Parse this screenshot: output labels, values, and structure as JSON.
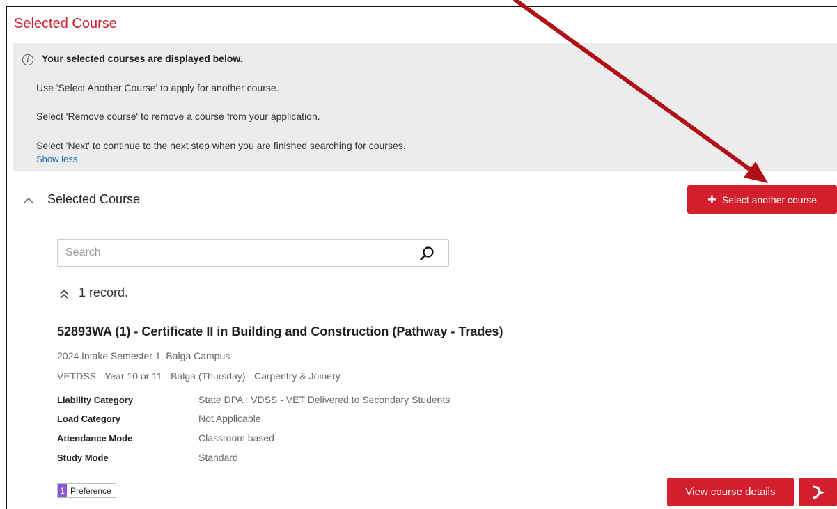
{
  "page": {
    "title": "Selected Course"
  },
  "info": {
    "heading": "Your selected courses are displayed below.",
    "lines": [
      "Use 'Select Another Course' to apply for another course.",
      "Select 'Remove course' to remove a course from your application.",
      "Select 'Next' to continue to the next step when you are finished searching for courses."
    ],
    "show_less": "Show less",
    "icon": "info-icon"
  },
  "section": {
    "title": "Selected Course",
    "toggle_icon": "chevron-up-icon",
    "select_another_label": "Select another course",
    "select_another_icon": "plus-icon"
  },
  "search": {
    "placeholder": "Search",
    "value": "",
    "icon": "search-icon"
  },
  "records": {
    "count_label": "1 record.",
    "collapse_icon": "double-chevron-up-icon"
  },
  "course": {
    "title": "52893WA (1) - Certificate II in Building and Construction (Pathway - Trades)",
    "intake": "2024 Intake Semester 1, Balga Campus",
    "stream": "VETDSS - Year 10 or 11 - Balga (Thursday) - Carpentry & Joinery",
    "details": [
      {
        "label": "Liability Category",
        "value": "State DPA : VDSS - VET Delivered to Secondary Students"
      },
      {
        "label": "Load Category",
        "value": "Not Applicable"
      },
      {
        "label": "Attendance Mode",
        "value": "Classroom based"
      },
      {
        "label": "Study Mode",
        "value": "Standard"
      }
    ],
    "preference_number": "1",
    "preference_label": "Preference",
    "view_details_label": "View course details",
    "action_icon": "exit-arrow-icon"
  },
  "colors": {
    "accent_red": "#d31f2d",
    "title_red": "#d0202e",
    "annotation_arrow": "#b01015",
    "link_blue": "#1a6fb5",
    "preference_purple": "#8b55d8",
    "info_bg": "#ececec"
  }
}
